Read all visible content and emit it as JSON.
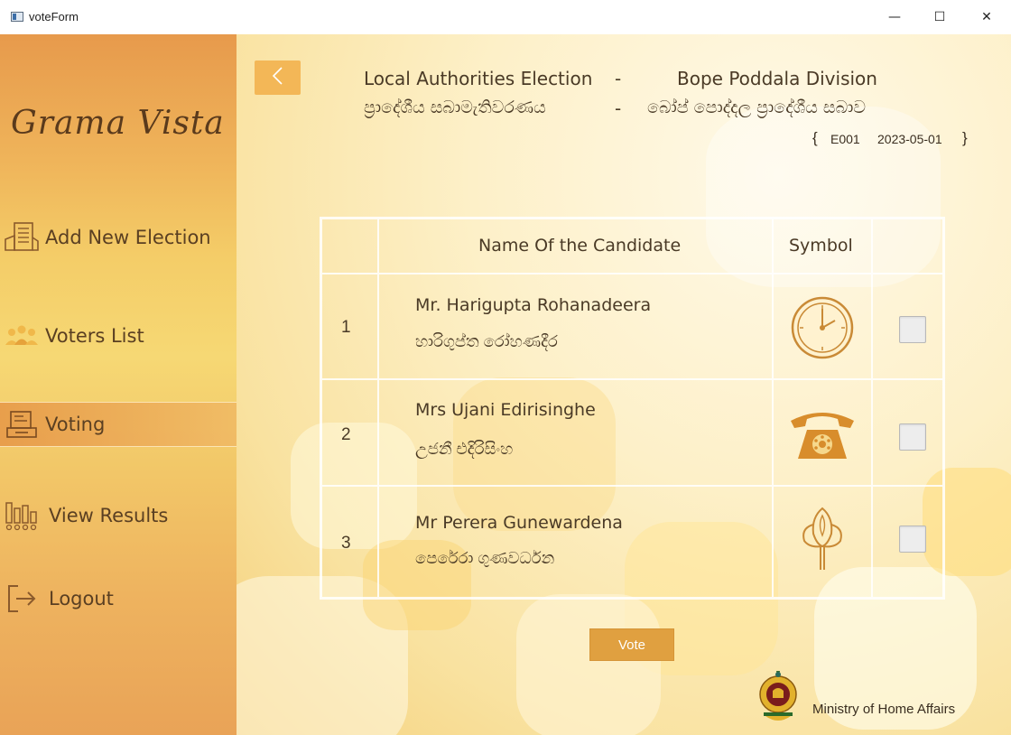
{
  "window": {
    "title": "voteForm",
    "minimize_glyph": "—",
    "maximize_glyph": "☐",
    "close_glyph": "✕"
  },
  "sidebar": {
    "logo": "Grama Vista",
    "items": [
      {
        "label": "Add New Election",
        "icon": "ballot-box-icon"
      },
      {
        "label": "Voters List",
        "icon": "people-icon"
      },
      {
        "label": "Voting",
        "icon": "voting-machine-icon"
      },
      {
        "label": "View Results",
        "icon": "bar-chart-icon"
      },
      {
        "label": "Logout",
        "icon": "logout-icon"
      }
    ],
    "active": "Voting"
  },
  "header": {
    "election_en": "Local Authorities Election",
    "separator": "-",
    "division_en": "Bope Poddala Division",
    "election_si": "ප්‍රාදේශීය සබාමැතිවරණය",
    "division_si": "බෝප් පොද්දල ප්‍රාදේශීය සබාව",
    "brace_open": "{",
    "election_id": "E001",
    "election_date": "2023-05-01",
    "brace_close": "}"
  },
  "table": {
    "col_name": "Name Of the Candidate",
    "col_symbol": "Symbol",
    "rows": [
      {
        "no": "1",
        "name_en": "Mr. Harigupta Rohanadeera",
        "name_si": "හාරිගුප්ත රෝහණදීර",
        "symbol": "clock-symbol",
        "checked": false
      },
      {
        "no": "2",
        "name_en": "Mrs Ujani Edirisinghe",
        "name_si": "උජනී එදිරිසිංහ",
        "symbol": "telephone-symbol",
        "checked": false
      },
      {
        "no": "3",
        "name_en": "Mr Perera Gunewardena",
        "name_si": "පෙරේරා ගුණවර්ධන",
        "symbol": "lotus-symbol",
        "checked": false
      }
    ]
  },
  "vote_button": "Vote",
  "footer": {
    "ministry": "Ministry of Home Affairs"
  },
  "colors": {
    "accent": "#f3b757",
    "sidebar_top": "#e79a4c",
    "sidebar_mid": "#f6d874",
    "text": "#4a3a26",
    "button": "#e0a040"
  }
}
